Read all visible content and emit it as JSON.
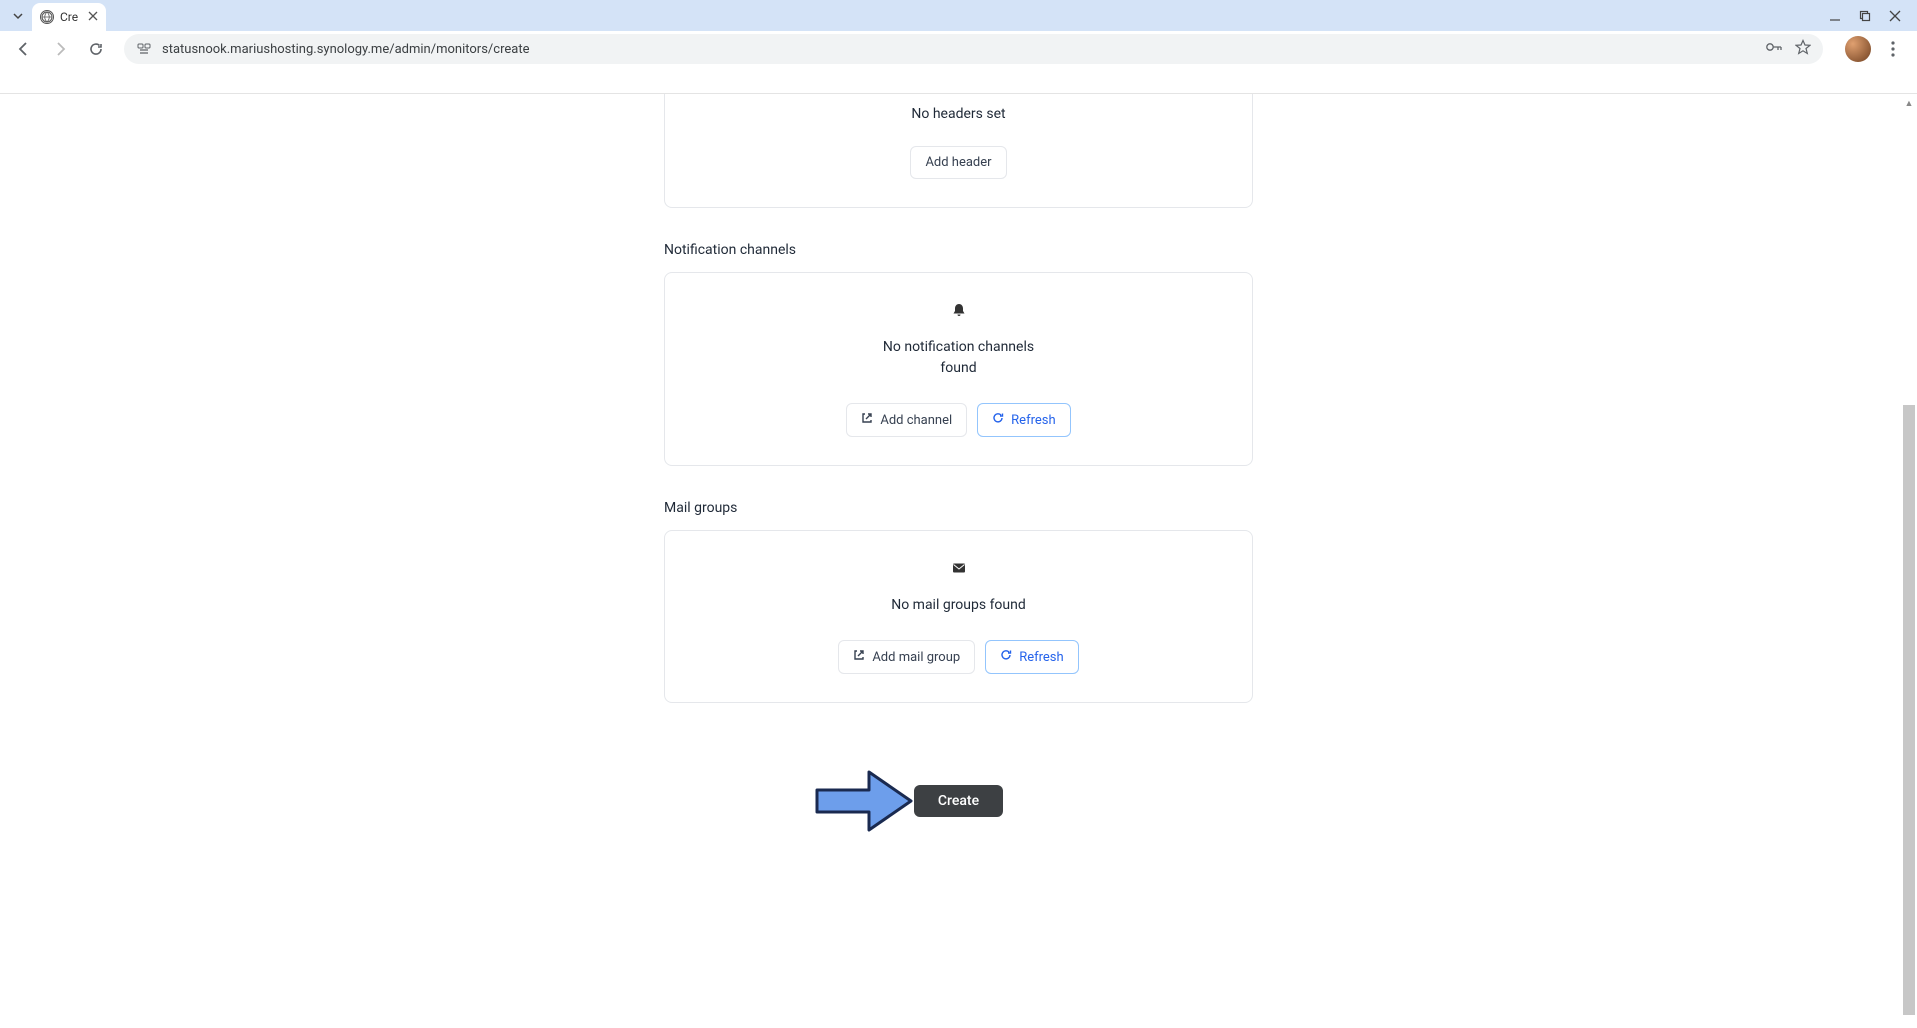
{
  "browser": {
    "tab_title": "Cre",
    "url": "statusnook.mariushosting.synology.me/admin/monitors/create"
  },
  "headers_section": {
    "empty_text": "No headers set",
    "add_button": "Add header"
  },
  "notification_section": {
    "label": "Notification channels",
    "empty_text": "No notification channels found",
    "add_button": "Add channel",
    "refresh_button": "Refresh"
  },
  "mail_section": {
    "label": "Mail groups",
    "empty_text": "No mail groups found",
    "add_button": "Add mail group",
    "refresh_button": "Refresh"
  },
  "submit": {
    "create_button": "Create"
  }
}
